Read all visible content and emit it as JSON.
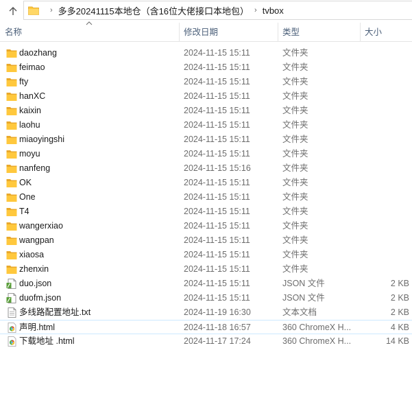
{
  "address": {
    "crumbs": [
      "多多20241115本地仓（含16位大佬接口本地包）",
      "tvbox"
    ]
  },
  "columns": {
    "name": "名称",
    "date": "修改日期",
    "type": "类型",
    "size": "大小"
  },
  "files": [
    {
      "name": "daozhang",
      "date": "2024-11-15 15:11",
      "type": "文件夹",
      "size": "",
      "icon": "folder-icon"
    },
    {
      "name": "feimao",
      "date": "2024-11-15 15:11",
      "type": "文件夹",
      "size": "",
      "icon": "folder-icon"
    },
    {
      "name": "fty",
      "date": "2024-11-15 15:11",
      "type": "文件夹",
      "size": "",
      "icon": "folder-icon"
    },
    {
      "name": "hanXC",
      "date": "2024-11-15 15:11",
      "type": "文件夹",
      "size": "",
      "icon": "folder-icon"
    },
    {
      "name": "kaixin",
      "date": "2024-11-15 15:11",
      "type": "文件夹",
      "size": "",
      "icon": "folder-icon"
    },
    {
      "name": "laohu",
      "date": "2024-11-15 15:11",
      "type": "文件夹",
      "size": "",
      "icon": "folder-icon"
    },
    {
      "name": "miaoyingshi",
      "date": "2024-11-15 15:11",
      "type": "文件夹",
      "size": "",
      "icon": "folder-icon"
    },
    {
      "name": "moyu",
      "date": "2024-11-15 15:11",
      "type": "文件夹",
      "size": "",
      "icon": "folder-icon"
    },
    {
      "name": "nanfeng",
      "date": "2024-11-15 15:16",
      "type": "文件夹",
      "size": "",
      "icon": "folder-icon"
    },
    {
      "name": "OK",
      "date": "2024-11-15 15:11",
      "type": "文件夹",
      "size": "",
      "icon": "folder-icon"
    },
    {
      "name": "One",
      "date": "2024-11-15 15:11",
      "type": "文件夹",
      "size": "",
      "icon": "folder-icon"
    },
    {
      "name": "T4",
      "date": "2024-11-15 15:11",
      "type": "文件夹",
      "size": "",
      "icon": "folder-icon"
    },
    {
      "name": "wangerxiao",
      "date": "2024-11-15 15:11",
      "type": "文件夹",
      "size": "",
      "icon": "folder-icon"
    },
    {
      "name": "wangpan",
      "date": "2024-11-15 15:11",
      "type": "文件夹",
      "size": "",
      "icon": "folder-icon"
    },
    {
      "name": "xiaosa",
      "date": "2024-11-15 15:11",
      "type": "文件夹",
      "size": "",
      "icon": "folder-icon"
    },
    {
      "name": "zhenxin",
      "date": "2024-11-15 15:11",
      "type": "文件夹",
      "size": "",
      "icon": "folder-icon"
    },
    {
      "name": "duo.json",
      "date": "2024-11-15 15:11",
      "type": "JSON 文件",
      "size": "2 KB",
      "icon": "json-file-icon"
    },
    {
      "name": "duofm.json",
      "date": "2024-11-15 15:11",
      "type": "JSON 文件",
      "size": "2 KB",
      "icon": "json-file-icon"
    },
    {
      "name": "多线路配置地址.txt",
      "date": "2024-11-19 16:30",
      "type": "文本文档",
      "size": "2 KB",
      "icon": "text-file-icon"
    },
    {
      "name": "声明.html",
      "date": "2024-11-18 16:57",
      "type": "360 ChromeX H...",
      "size": "4 KB",
      "icon": "html-file-icon"
    },
    {
      "name": "下载地址 .html",
      "date": "2024-11-17 17:24",
      "type": "360 ChromeX H...",
      "size": "14 KB",
      "icon": "html-file-icon"
    }
  ],
  "selected_index": 19,
  "colors": {
    "folder": "#ffc83d",
    "header_text": "#4c607a",
    "secondary_text": "#6d6d6d",
    "selection_border": "#cce8ff"
  }
}
